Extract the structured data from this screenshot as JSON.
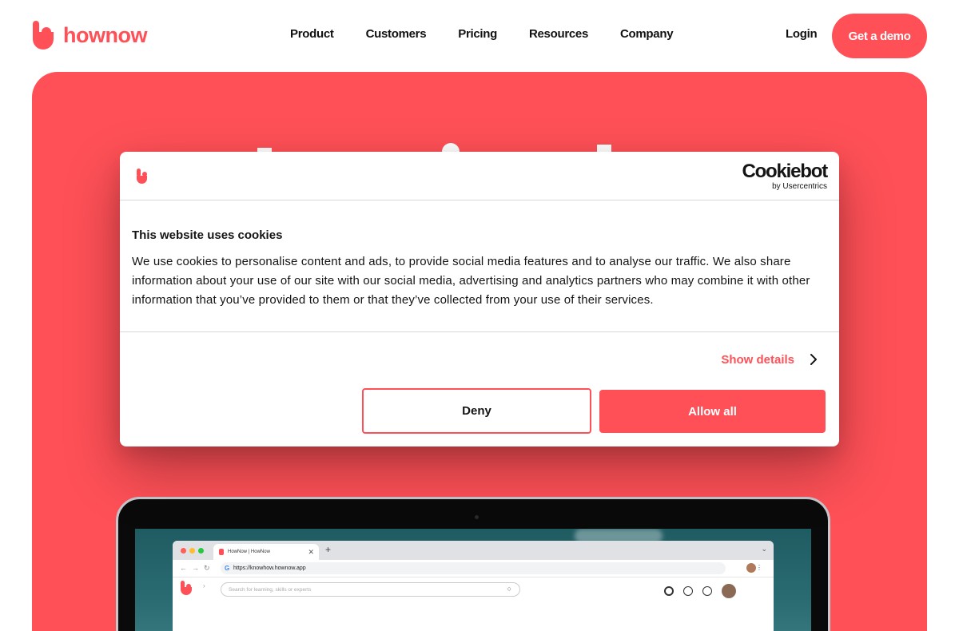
{
  "header": {
    "brand": "hownow",
    "nav": [
      "Product",
      "Customers",
      "Pricing",
      "Resources",
      "Company"
    ],
    "login": "Login",
    "cta": "Get a demo"
  },
  "colors": {
    "brand": "#ff5057",
    "text": "#141414",
    "background": "#ffffff"
  },
  "browser": {
    "tab_title": "HowNow | HowNow",
    "url": "https://knowhow.hownow.app",
    "search_placeholder": "Search for learning, skills or experts"
  },
  "cookie_dialog": {
    "provider": "Cookiebot",
    "provider_sub": "by Usercentrics",
    "title": "This website uses cookies",
    "text": "We use cookies to personalise content and ads, to provide social media features and to analyse our traffic. We also share information about your use of our site with our social media, advertising and analytics partners who may combine it with other information that you’ve provided to them or that they’ve collected from your use of their services.",
    "show_details": "Show details",
    "deny": "Deny",
    "allow_all": "Allow all"
  }
}
